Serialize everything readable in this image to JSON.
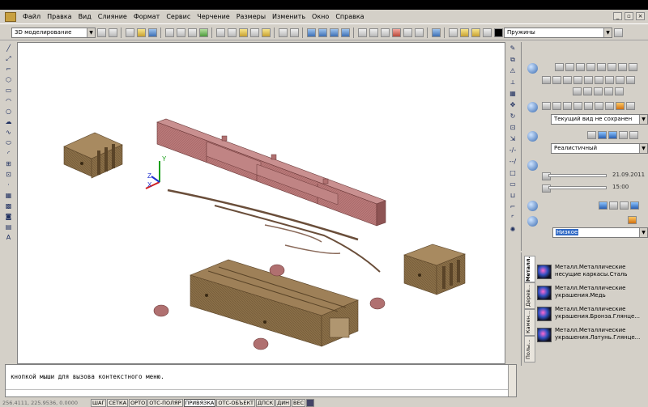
{
  "menu": [
    "Файл",
    "Правка",
    "Вид",
    "Слияние",
    "Формат",
    "Сервис",
    "Черчение",
    "Размеры",
    "Изменить",
    "Окно",
    "Справка"
  ],
  "workspace_combo": "3D моделирование",
  "layer_combo": "Пружины",
  "palette": {
    "view_combo": "Текущий вид не сохранен",
    "visual_style_combo": "Реалистичный",
    "date_value": "21.09.2011",
    "time_value": "15:00",
    "quality_combo": "Низкое"
  },
  "materials": {
    "tabs": [
      "Металл...",
      "Дерев...",
      "Камен...",
      "Полы..."
    ],
    "items": [
      "Металл.Металлические несущие каркасы.Сталь",
      "Металл.Металлические украшения.Медь",
      "Металл.Металлические украшения.Бронза.Глянце...",
      "Металл.Металлические украшения.Латунь.Глянце..."
    ]
  },
  "command": {
    "text": "кнопкой мыши для вызова контекстного меню."
  },
  "status": {
    "coords": "256.4111, 225.9536, 0.0000",
    "buttons": [
      "ШАГ",
      "СЕТКА",
      "ОРТО",
      "ОТС-ПОЛЯР",
      "ПРИВЯЗКА",
      "ОТС-ОБЪЕКТ",
      "ДПСК",
      "ДИН",
      "ВЕС"
    ]
  },
  "colors": {
    "beam": "#b87878",
    "wood": "#8a6f48",
    "background": "#ffffff"
  }
}
